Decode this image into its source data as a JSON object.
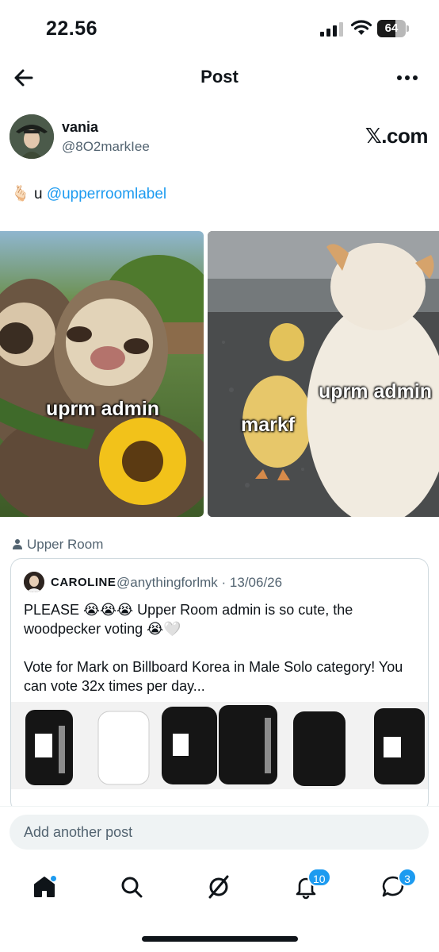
{
  "status_bar": {
    "time": "22.56",
    "battery": "64",
    "battery_level": 0.64
  },
  "header": {
    "title": "Post"
  },
  "author": {
    "name": "vania",
    "handle": "@8O2markIee",
    "source": "𝕏.com"
  },
  "post": {
    "emoji": "🫰🏻",
    "text_prefix": "u",
    "mention": "@upperroomlabel"
  },
  "media": {
    "left_caption": "uprm admin",
    "right_caption_1": "uprm admin",
    "right_caption_2": "markf"
  },
  "community": {
    "label": "Upper Room"
  },
  "quote": {
    "name": "CAROLINE",
    "handle_date": "@anythingforlmk · 13/06/26",
    "text": "PLEASE 😭😭😭 Upper Room admin is so cute, the woodpecker voting 😭🤍\n\nVote for Mark on Billboard Korea in Male Solo category! You can vote 32x times per day..."
  },
  "composer": {
    "placeholder": "Add another post"
  },
  "tabs": {
    "notifications_badge": "10",
    "messages_badge": "3"
  }
}
